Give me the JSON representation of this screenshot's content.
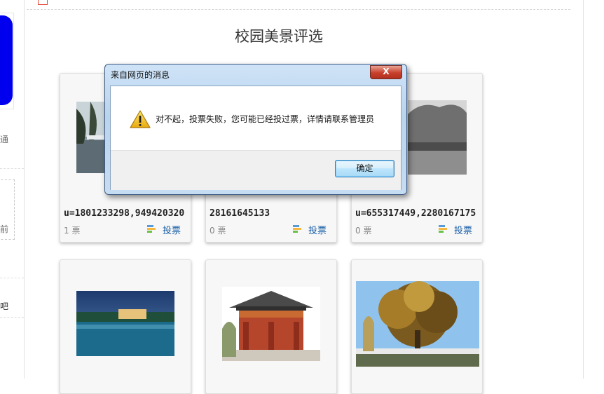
{
  "page": {
    "title": "校园美景评选"
  },
  "sidebar": {
    "text_1": "通",
    "text_2": "前",
    "text_3": "吧"
  },
  "cards": [
    {
      "caption": "u=1801233298,949420320",
      "votes": "1 票",
      "vote_label": "投票"
    },
    {
      "caption": "28161645133",
      "votes": "0 票",
      "vote_label": "投票"
    },
    {
      "caption": "u=655317449,2280167175",
      "votes": "0 票",
      "vote_label": "投票"
    },
    {
      "caption": "",
      "votes": "",
      "vote_label": ""
    },
    {
      "caption": "",
      "votes": "",
      "vote_label": ""
    },
    {
      "caption": "",
      "votes": "",
      "vote_label": ""
    }
  ],
  "dialog": {
    "title": "来自网页的消息",
    "close_label": "X",
    "message": "对不起，投票失败，您可能已经投过票，详情请联系管理员",
    "ok_label": "确定"
  },
  "colors": {
    "accent_blue": "#0000ee",
    "link": "#1a5fa8",
    "dialog_border": "#3d5b84"
  }
}
